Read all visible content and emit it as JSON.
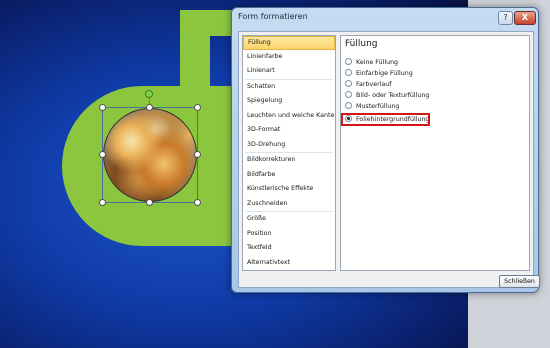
{
  "dialog": {
    "title": "Form formatieren",
    "help_label": "?",
    "close_label": "X",
    "close_button_label": "Schließen"
  },
  "categories": [
    "Füllung",
    "Linienfarbe",
    "Linienart",
    "Schatten",
    "Spiegelung",
    "Leuchten und weiche Kanten",
    "3D-Format",
    "3D-Drehung",
    "Bildkorrekturen",
    "Bildfarbe",
    "Künstlerische Effekte",
    "Zuschneiden",
    "Größe",
    "Position",
    "Textfeld",
    "Alternativtext"
  ],
  "panel": {
    "title": "Füllung",
    "options": [
      "Keine Füllung",
      "Einfarbige Füllung",
      "Farbverlauf",
      "Bild- oder Texturfüllung",
      "Musterfüllung",
      "Foliehintergrundfüllung"
    ],
    "selected_index": 5
  }
}
